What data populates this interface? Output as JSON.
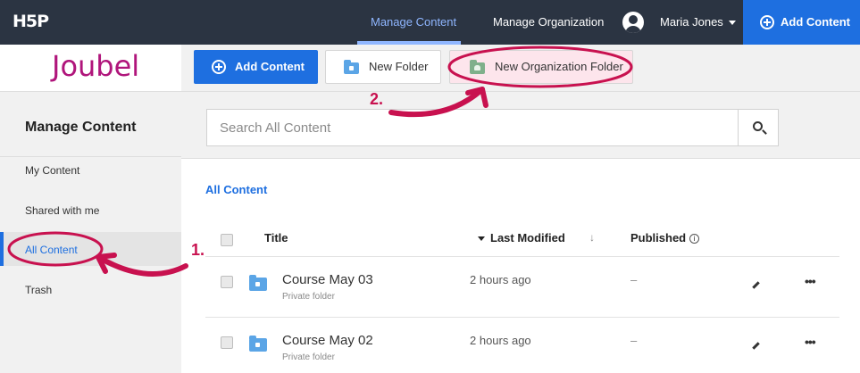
{
  "topnav": {
    "logo": "H5P",
    "links": [
      "Manage Content",
      "Manage Organization"
    ],
    "user_name": "Maria Jones",
    "add_content_label": "Add Content"
  },
  "brand": {
    "name": "Joubel"
  },
  "toolbar": {
    "add_content_label": "Add Content",
    "new_folder_label": "New Folder",
    "new_org_folder_label": "New Organization Folder"
  },
  "sidebar": {
    "title": "Manage Content",
    "items": [
      "My Content",
      "Shared with me",
      "All Content",
      "Trash"
    ],
    "active_index": 2
  },
  "search": {
    "placeholder": "Search All Content"
  },
  "breadcrumb": "All Content",
  "table": {
    "headers": {
      "title": "Title",
      "last_modified": "Last Modified",
      "published": "Published"
    },
    "rows": [
      {
        "title": "Course May 03",
        "subtitle": "Private folder",
        "modified": "2 hours ago",
        "published": "–"
      },
      {
        "title": "Course May 02",
        "subtitle": "Private folder",
        "modified": "2 hours ago",
        "published": "–"
      }
    ]
  },
  "annotations": {
    "step1": "1.",
    "step2": "2."
  },
  "colors": {
    "nav_bg": "#2b3442",
    "primary": "#1e6fe0",
    "brand": "#b0157b",
    "annotation": "#c8114f",
    "org_folder_highlight": "#fde5ec"
  }
}
